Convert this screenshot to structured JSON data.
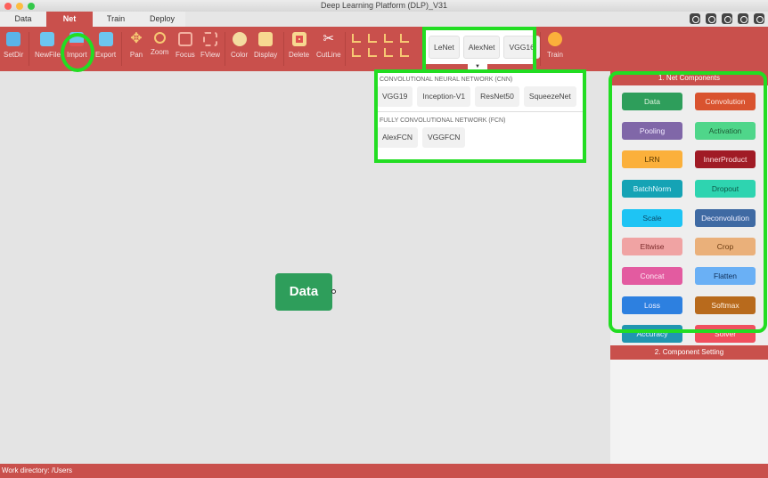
{
  "window": {
    "title": "Deep Learning Platform (DLP)_V31"
  },
  "tabs": [
    "Data",
    "Net",
    "Train",
    "Deploy"
  ],
  "toolbar": {
    "setdir": "SetDir",
    "newfile": "NewFile",
    "import": "Import",
    "export": "Export",
    "pan": "Pan",
    "zoom": "Zoom",
    "focus": "Focus",
    "fview": "FView",
    "color": "Color",
    "display": "Display",
    "delete": "Delete",
    "cutline": "CutLine",
    "train": "Train"
  },
  "nets": {
    "quick": [
      "LeNet",
      "AlexNet",
      "VGG16"
    ],
    "cnn_title": "CONVOLUTIONAL NEURAL NETWORK (CNN)",
    "cnn": [
      "VGG19",
      "Inception-V1",
      "ResNet50",
      "SqueezeNet"
    ],
    "fcn_title": "FULLY CONVOLUTIONAL NETWORK (FCN)",
    "fcn": [
      "AlexFCN",
      "VGGFCN"
    ]
  },
  "panel": {
    "title1": "1. Net Components",
    "title2": "2. Component Setting",
    "components": [
      {
        "label": "Data",
        "color": "#2e9e5b",
        "text": "#e0f4e0"
      },
      {
        "label": "Convolution",
        "color": "#d9532f",
        "text": "#ffe8e0"
      },
      {
        "label": "Pooling",
        "color": "#8067a8",
        "text": "#f0e8ff"
      },
      {
        "label": "Activation",
        "color": "#4fd68a",
        "text": "#1d5a35"
      },
      {
        "label": "LRN",
        "color": "#fbb03b",
        "text": "#5a3a00"
      },
      {
        "label": "InnerProduct",
        "color": "#a01b25",
        "text": "#ffe0e0"
      },
      {
        "label": "BatchNorm",
        "color": "#15a3b5",
        "text": "#e0f8ff"
      },
      {
        "label": "Dropout",
        "color": "#2ed4b0",
        "text": "#0f5a4a"
      },
      {
        "label": "Scale",
        "color": "#1ec4f4",
        "text": "#0a4a6a"
      },
      {
        "label": "Deconvolution",
        "color": "#3f6aa3",
        "text": "#eef"
      },
      {
        "label": "Eltwise",
        "color": "#f0a3a3",
        "text": "#7a2a2a"
      },
      {
        "label": "Crop",
        "color": "#eab07a",
        "text": "#6a3a10"
      },
      {
        "label": "Concat",
        "color": "#e35ba0",
        "text": "#ffe8f4"
      },
      {
        "label": "Flatten",
        "color": "#6ab0f5",
        "text": "#10305a"
      },
      {
        "label": "Loss",
        "color": "#2d80e0",
        "text": "#eef"
      },
      {
        "label": "Softmax",
        "color": "#b86a1c",
        "text": "#fff0e0"
      },
      {
        "label": "Accuracy",
        "color": "#2196b0",
        "text": "#e8faff"
      },
      {
        "label": "Solver",
        "color": "#f04f5e",
        "text": "#fff0f0"
      }
    ]
  },
  "canvas": {
    "node": "Data"
  },
  "status": "Work directory: /Users"
}
